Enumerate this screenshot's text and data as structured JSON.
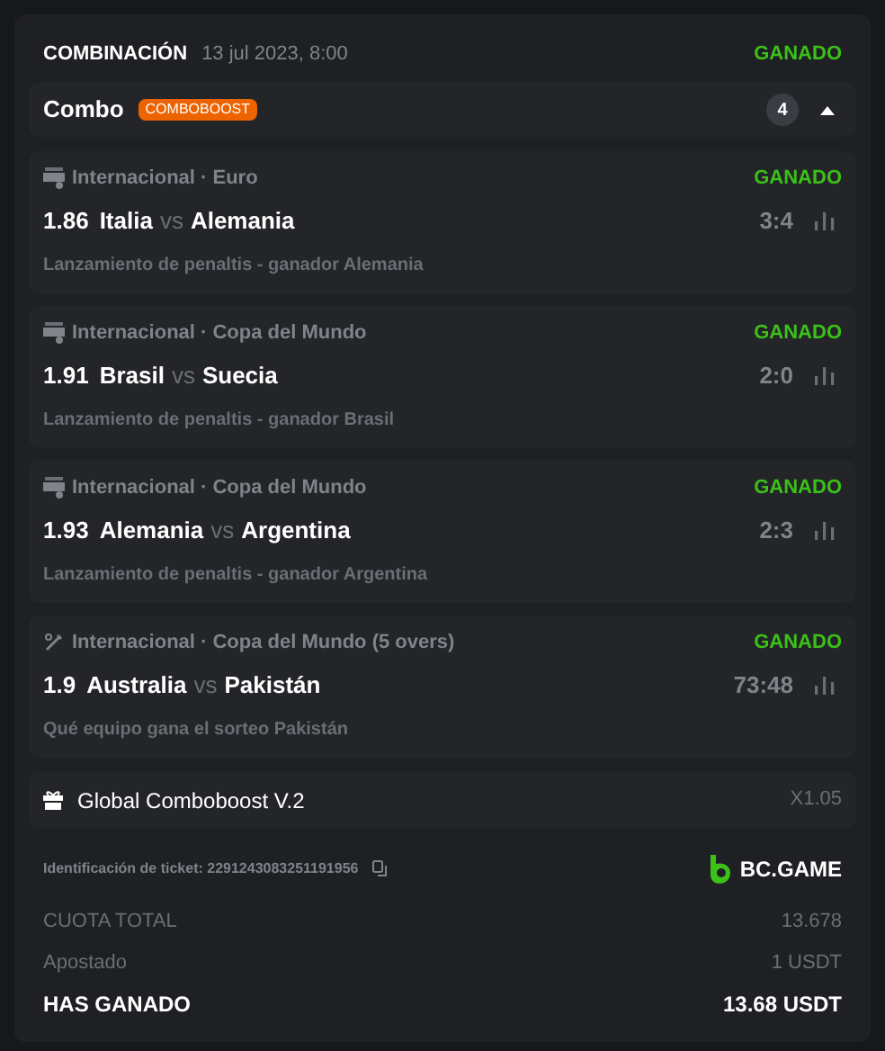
{
  "header": {
    "type": "COMBINACIÓN",
    "date": "13 jul 2023, 8:00",
    "status": "GANADO",
    "color": "#3bc117"
  },
  "combo": {
    "label": "Combo",
    "badge": "COMBOBOOST",
    "count": "4",
    "expanded": true
  },
  "legs": [
    {
      "kind": "fifa",
      "league": "Internacional · Euro",
      "status": "GANADO",
      "color": "#3bc117",
      "odds": "1.86",
      "home": "Italia",
      "separator": "vs",
      "away": "Alemania",
      "score": "3:4",
      "market": "Lanzamiento de penaltis - ganador Alemania"
    },
    {
      "kind": "fifa",
      "league": "Internacional · Copa del Mundo",
      "status": "GANADO",
      "color": "#3bc117",
      "odds": "1.91",
      "home": "Brasil",
      "separator": "vs",
      "away": "Suecia",
      "score": "2:0",
      "market": "Lanzamiento de penaltis - ganador Brasil"
    },
    {
      "kind": "fifa",
      "league": "Internacional · Copa del Mundo",
      "status": "GANADO",
      "color": "#3bc117",
      "odds": "1.93",
      "home": "Alemania",
      "separator": "vs",
      "away": "Argentina",
      "score": "2:3",
      "market": "Lanzamiento de penaltis - ganador Argentina"
    },
    {
      "kind": "cricket",
      "league": "Internacional · Copa del Mundo (5 overs)",
      "status": "GANADO",
      "color": "#3bc117",
      "odds": "1.9",
      "home": "Australia",
      "separator": "vs",
      "away": "Pakistán",
      "score": "73:48",
      "market": "Qué equipo gana el sorteo Pakistán"
    }
  ],
  "boost": {
    "label": "Global Comboboost V.2",
    "multiplier": "X1.05"
  },
  "ticket": {
    "label": "Identificación de ticket: 2291243083251191956",
    "brand": "BC.GAME"
  },
  "summary": [
    {
      "kind": "muted",
      "label": "CUOTA TOTAL",
      "value": "13.678"
    },
    {
      "kind": "muted",
      "label": "Apostado",
      "value": "1 USDT"
    },
    {
      "kind": "total",
      "label": "HAS GANADO",
      "value": "13.68 USDT"
    }
  ]
}
